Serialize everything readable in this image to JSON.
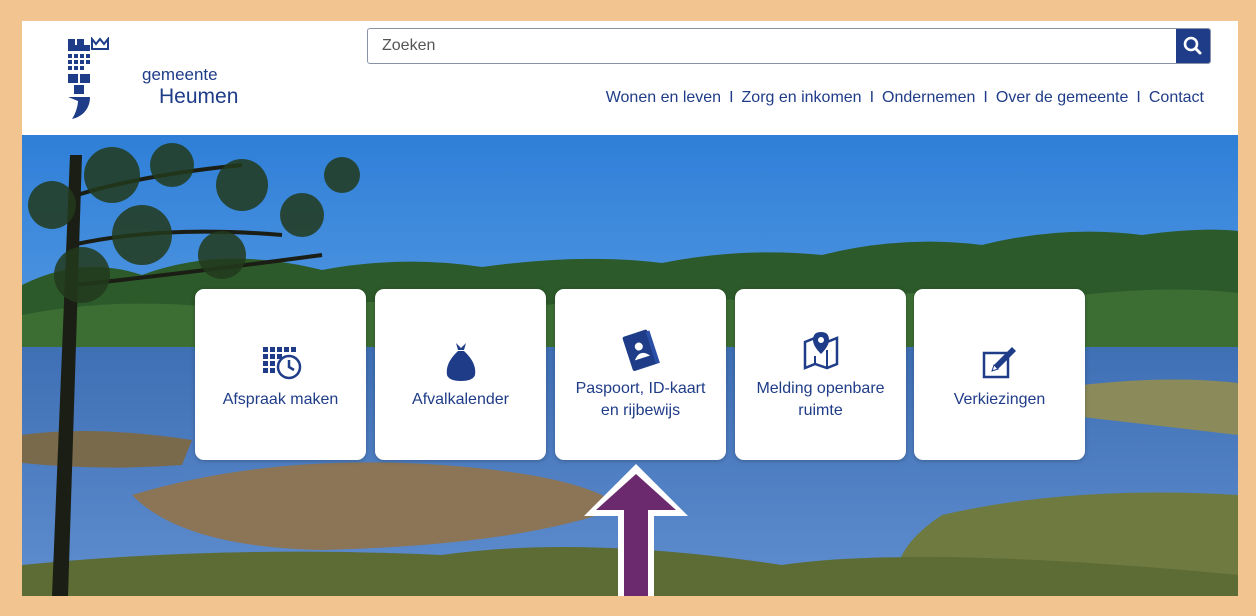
{
  "logo": {
    "line1": "gemeente",
    "line2": "Heumen",
    "icon": "gemeente-heumen-crest"
  },
  "search": {
    "placeholder": "Zoeken",
    "value": "",
    "button_icon": "search-icon"
  },
  "nav": {
    "items": [
      "Wonen en leven",
      "Zorg en inkomen",
      "Ondernemen",
      "Over de gemeente",
      "Contact"
    ],
    "separator": "I"
  },
  "tiles": [
    {
      "label": "Afspraak maken",
      "icon": "calendar-clock-icon"
    },
    {
      "label": "Afvalkalender",
      "icon": "garbage-bag-icon"
    },
    {
      "label": "Paspoort, ID-kaart en rijbewijs",
      "icon": "id-card-icon"
    },
    {
      "label": "Melding openbare ruimte",
      "icon": "map-pin-icon"
    },
    {
      "label": "Verkiezingen",
      "icon": "pencil-icon"
    }
  ],
  "colors": {
    "brand": "#1f3c88",
    "border": "#f2c48f",
    "arrow": "#6b2a6e"
  }
}
